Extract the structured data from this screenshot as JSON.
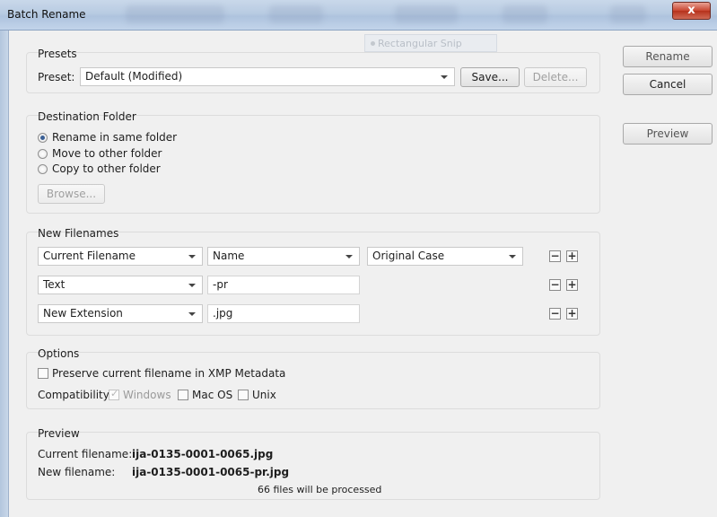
{
  "window": {
    "title": "Batch Rename",
    "close_glyph": "x"
  },
  "ghost_tooltip": "Rectangular Snip",
  "presets": {
    "group_title": "Presets",
    "label": "Preset:",
    "value": "Default (Modified)",
    "save_label": "Save...",
    "delete_label": "Delete..."
  },
  "destination": {
    "group_title": "Destination Folder",
    "options": [
      "Rename in same folder",
      "Move to other folder",
      "Copy to other folder"
    ],
    "selected": "Rename in same folder",
    "browse_label": "Browse..."
  },
  "new_filenames": {
    "group_title": "New Filenames",
    "rows": [
      {
        "type": "Current Filename",
        "field": "Name",
        "case": "Original Case"
      },
      {
        "type": "Text",
        "value": "-pr"
      },
      {
        "type": "New Extension",
        "value": ".jpg"
      }
    ],
    "minus_glyph": "−",
    "plus_glyph": "+"
  },
  "options": {
    "group_title": "Options",
    "preserve_label": "Preserve current filename in XMP Metadata",
    "compat_label": "Compatibility:",
    "windows_label": "Windows",
    "mac_label": "Mac OS",
    "unix_label": "Unix"
  },
  "preview": {
    "group_title": "Preview",
    "current_label": "Current filename:",
    "current_value": "ija-0135-0001-0065.jpg",
    "new_label": "New filename:",
    "new_value": "ija-0135-0001-0065-pr.jpg",
    "count_text": "66 files will be processed"
  },
  "side_buttons": {
    "rename": "Rename",
    "cancel": "Cancel",
    "preview": "Preview"
  },
  "colors": {
    "title_bar": "#b8cbe2",
    "close_button": "#c8452f",
    "background": "#f0f0f0"
  }
}
